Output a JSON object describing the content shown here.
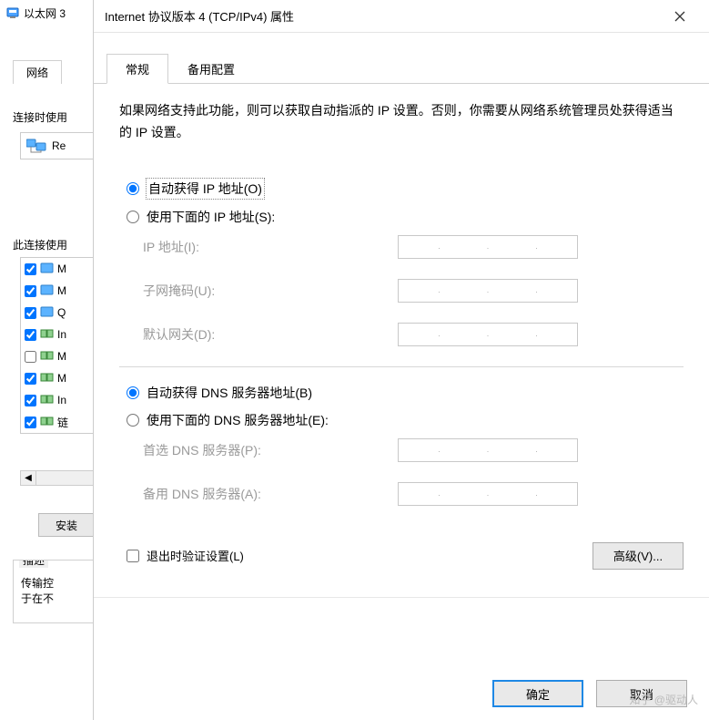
{
  "back": {
    "ethernet_label": "以太网 3",
    "tab_network": "网络",
    "connect_using": "连接时使用",
    "adapter": "Re",
    "this_connection": "此连接使用",
    "items": [
      {
        "checked": true,
        "text": "M"
      },
      {
        "checked": true,
        "text": "M"
      },
      {
        "checked": true,
        "text": "Q"
      },
      {
        "checked": true,
        "text": "In"
      },
      {
        "checked": false,
        "text": "M"
      },
      {
        "checked": true,
        "text": "M"
      },
      {
        "checked": true,
        "text": "In"
      },
      {
        "checked": true,
        "text": "链"
      }
    ],
    "install": "安装",
    "desc_legend": "描述",
    "desc_text1": "传输控",
    "desc_text2": "于在不"
  },
  "dialog": {
    "title": "Internet 协议版本 4 (TCP/IPv4) 属性",
    "tabs": {
      "general": "常规",
      "alt": "备用配置"
    },
    "intro": "如果网络支持此功能，则可以获取自动指派的 IP 设置。否则，你需要从网络系统管理员处获得适当的 IP 设置。",
    "ip_auto": "自动获得 IP 地址(O)",
    "ip_manual": "使用下面的 IP 地址(S):",
    "ip_addr_label": "IP 地址(I):",
    "subnet_label": "子网掩码(U):",
    "gateway_label": "默认网关(D):",
    "dns_auto": "自动获得 DNS 服务器地址(B)",
    "dns_manual": "使用下面的 DNS 服务器地址(E):",
    "dns_pref_label": "首选 DNS 服务器(P):",
    "dns_alt_label": "备用 DNS 服务器(A):",
    "validate": "退出时验证设置(L)",
    "advanced": "高级(V)...",
    "ok": "确定",
    "cancel": "取消"
  },
  "watermark": "知乎 @驱动人"
}
